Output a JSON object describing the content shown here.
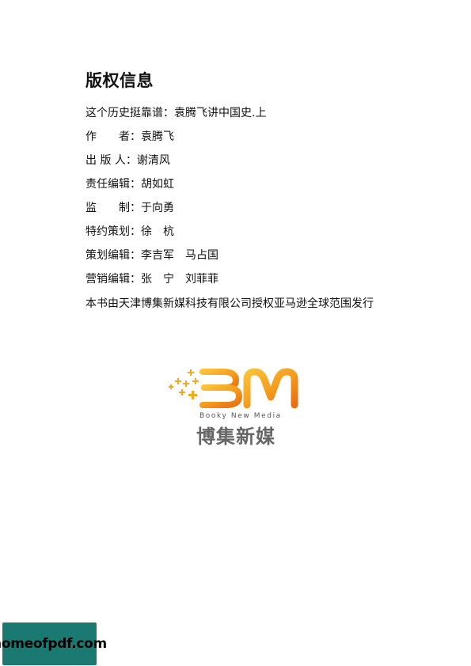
{
  "page": {
    "title": "版权信息"
  },
  "info": [
    "这个历史挺靠谱：袁腾飞讲中国史.上",
    "作　　者：袁腾飞",
    "出 版 人：谢清风",
    "责任编辑：胡如虹",
    "监　　制：于向勇",
    "特约策划：徐　杭",
    "策划编辑：李吉军　马占国",
    "营销编辑：张　宁　刘菲菲"
  ],
  "distribution": "本书由天津博集新媒科技有限公司授权亚马逊全球范围发行",
  "logo": {
    "mark": "BM",
    "tagline": "Booky New Media",
    "chinese_name": "博集新媒",
    "accent_color": "#f5a01a",
    "name_color": "#666666"
  },
  "watermark": {
    "text": "homeofpdf.com",
    "background_color": "#1a7a72"
  }
}
